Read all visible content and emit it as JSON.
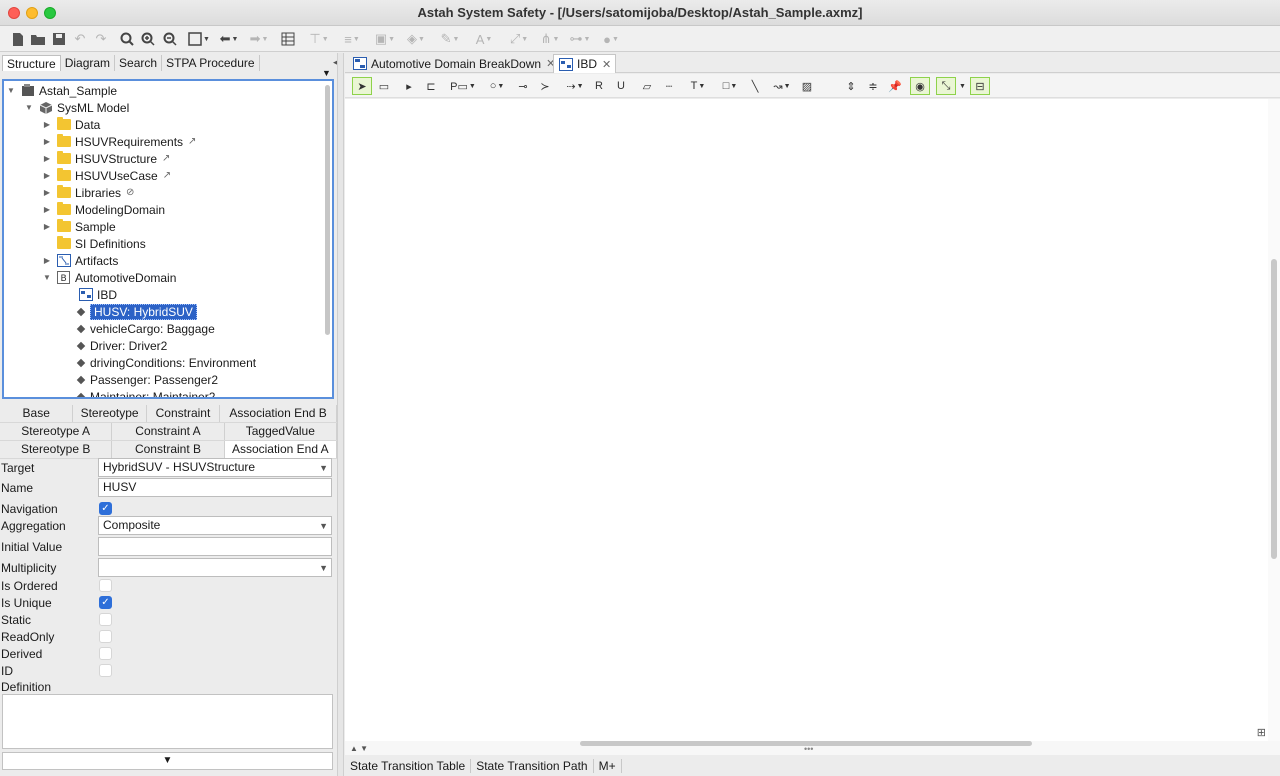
{
  "window": {
    "title": "Astah System Safety - [/Users/satomijoba/Desktop/Astah_Sample.axmz]"
  },
  "left_tabs": [
    "Structure",
    "Diagram",
    "Search",
    "STPA Procedure"
  ],
  "tree": {
    "root": "Astah_Sample",
    "model": "SysML Model",
    "items": [
      {
        "label": "Data"
      },
      {
        "label": "HSUVRequirements"
      },
      {
        "label": "HSUVStructure"
      },
      {
        "label": "HSUVUseCase"
      },
      {
        "label": "Libraries"
      },
      {
        "label": "ModelingDomain"
      },
      {
        "label": "Sample"
      },
      {
        "label": "SI Definitions"
      },
      {
        "label": "Artifacts"
      },
      {
        "label": "AutomotiveDomain"
      }
    ],
    "children": [
      {
        "label": "IBD"
      },
      {
        "label": "HUSV: HybridSUV"
      },
      {
        "label": "vehicleCargo: Baggage"
      },
      {
        "label": "Driver: Driver2"
      },
      {
        "label": "drivingConditions: Environment"
      },
      {
        "label": "Passenger: Passenger2"
      },
      {
        "label": "Maintainer: Maintainer2"
      }
    ]
  },
  "prop_tabs": {
    "row1": [
      "Base",
      "Stereotype",
      "Constraint",
      "Association End B"
    ],
    "row2": [
      "Stereotype A",
      "Constraint A",
      "TaggedValue"
    ],
    "row3": [
      "Stereotype B",
      "Constraint B",
      "Association End A"
    ]
  },
  "props": {
    "target_label": "Target",
    "target_value": "HybridSUV - HSUVStructure",
    "name_label": "Name",
    "name_value": "HUSV",
    "navigation_label": "Navigation",
    "navigation_checked": true,
    "aggregation_label": "Aggregation",
    "aggregation_value": "Composite",
    "initial_label": "Initial Value",
    "initial_value": "",
    "multiplicity_label": "Multiplicity",
    "multiplicity_value": "",
    "ordered_label": "Is Ordered",
    "ordered_checked": false,
    "unique_label": "Is Unique",
    "unique_checked": true,
    "static_label": "Static",
    "static_checked": false,
    "readonly_label": "ReadOnly",
    "readonly_checked": false,
    "derived_label": "Derived",
    "derived_checked": false,
    "id_label": "ID",
    "id_checked": false,
    "definition_label": "Definition",
    "definition_value": ""
  },
  "diagram_tabs": [
    "Automotive Domain BreakDown",
    "IBD"
  ],
  "bottom_tabs": [
    "State Transition Table",
    "State Transition Path",
    "M+"
  ],
  "colors": {
    "selection": "#2c62c6",
    "focus_border": "#5a8fdc",
    "checkbox": "#2e6fd9",
    "tool_highlight": "#8ed24b"
  }
}
